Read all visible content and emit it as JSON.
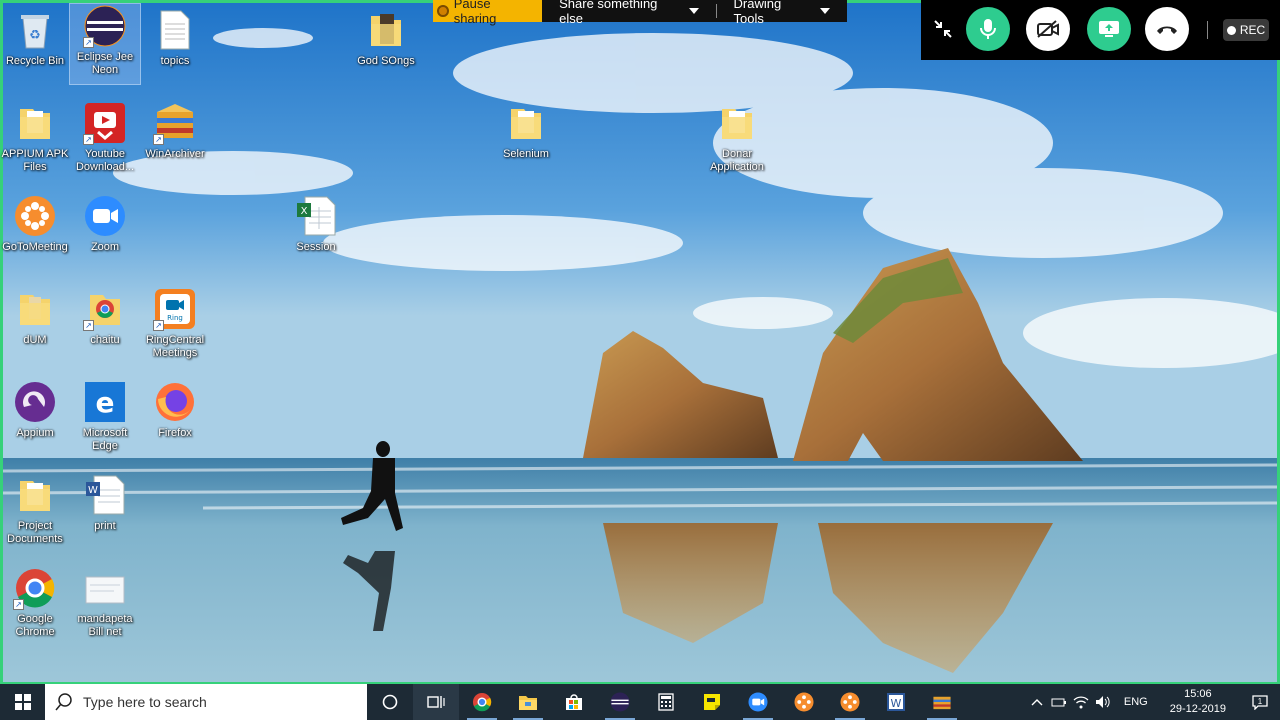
{
  "desktop": {
    "icons": [
      {
        "label": "Recycle Bin"
      },
      {
        "label": "Eclipse Jee Neon"
      },
      {
        "label": "topics"
      },
      {
        "label": "God SOngs"
      },
      {
        "label": "APPIUM APK Files"
      },
      {
        "label": "Youtube Download..."
      },
      {
        "label": "WinArchiver"
      },
      {
        "label": "Selenium"
      },
      {
        "label": "Donar Application"
      },
      {
        "label": "GoToMeeting"
      },
      {
        "label": "Zoom"
      },
      {
        "label": "Session"
      },
      {
        "label": "dUM"
      },
      {
        "label": "chaitu"
      },
      {
        "label": "RingCentral Meetings"
      },
      {
        "label": "Appium"
      },
      {
        "label": "Microsoft Edge"
      },
      {
        "label": "Firefox"
      },
      {
        "label": "Project Documents"
      },
      {
        "label": "print"
      },
      {
        "label": "Google Chrome"
      },
      {
        "label": "mandapeta Bill net"
      }
    ]
  },
  "share_toolbar": {
    "pause_label": "Pause sharing",
    "share_label": "Share something else",
    "drawing_label": "Drawing Tools"
  },
  "meeting_controls": {
    "rec_label": "REC",
    "accent": "#2ecc8f"
  },
  "taskbar": {
    "search_placeholder": "Type here to search",
    "language": "ENG",
    "time": "15:06",
    "date": "29-12-2019"
  }
}
